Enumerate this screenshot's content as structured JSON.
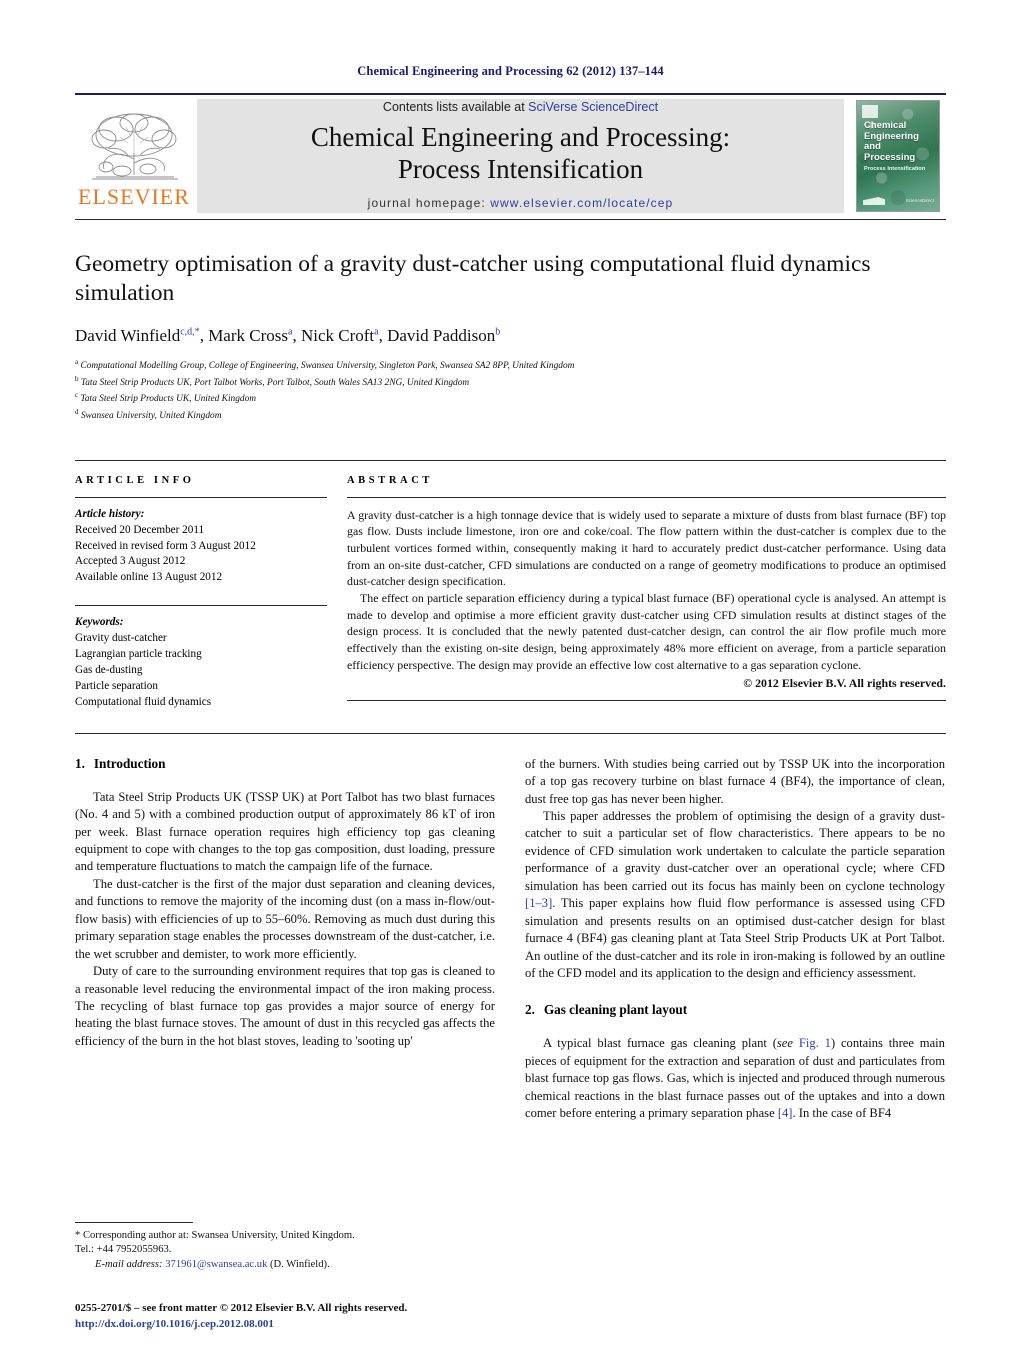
{
  "running_head": "Chemical Engineering and Processing 62 (2012) 137–144",
  "masthead": {
    "contents_prefix": "Contents lists available at ",
    "sciencedirect": "SciVerse ScienceDirect",
    "journal_title_line1": "Chemical Engineering and Processing:",
    "journal_title_line2": "Process Intensification",
    "homepage_label": "journal homepage: ",
    "homepage_url": "www.elsevier.com/locate/cep",
    "publisher_logo_text": "ELSEVIER",
    "cover": {
      "title": "Chemical Engineering and Processing",
      "subtitle": "Process Intensification",
      "bottom_text": "ScienceDirect"
    }
  },
  "article": {
    "title": "Geometry optimisation of a gravity dust-catcher using computational fluid dynamics simulation",
    "authors_html": "David Winfield<sup>c,d,</sup><sup>*</sup>, Mark Cross<sup>a</sup>, Nick Croft<sup>a</sup>, David Paddison<sup>b</sup>",
    "affiliations": [
      {
        "marker": "a",
        "text": "Computational Modelling Group, College of Engineering, Swansea University, Singleton Park, Swansea SA2 8PP, United Kingdom"
      },
      {
        "marker": "b",
        "text": "Tata Steel Strip Products UK, Port Talbot Works, Port Talbot, South Wales SA13 2NG, United Kingdom"
      },
      {
        "marker": "c",
        "text": "Tata Steel Strip Products UK, United Kingdom"
      },
      {
        "marker": "d",
        "text": "Swansea University, United Kingdom"
      }
    ]
  },
  "article_info": {
    "label": "ARTICLE INFO",
    "history_title": "Article history:",
    "history": [
      "Received 20 December 2011",
      "Received in revised form 3 August 2012",
      "Accepted 3 August 2012",
      "Available online 13 August 2012"
    ],
    "keywords_title": "Keywords:",
    "keywords": [
      "Gravity dust-catcher",
      "Lagrangian particle tracking",
      "Gas de-dusting",
      "Particle separation",
      "Computational fluid dynamics"
    ]
  },
  "abstract": {
    "label": "ABSTRACT",
    "paragraph1": "A gravity dust-catcher is a high tonnage device that is widely used to separate a mixture of dusts from blast furnace (BF) top gas flow. Dusts include limestone, iron ore and coke/coal. The flow pattern within the dust-catcher is complex due to the turbulent vortices formed within, consequently making it hard to accurately predict dust-catcher performance. Using data from an on-site dust-catcher, CFD simulations are conducted on a range of geometry modifications to produce an optimised dust-catcher design specification.",
    "paragraph2": "The effect on particle separation efficiency during a typical blast furnace (BF) operational cycle is analysed. An attempt is made to develop and optimise a more efficient gravity dust-catcher using CFD simulation results at distinct stages of the design process. It is concluded that the newly patented dust-catcher design, can control the air flow profile much more effectively than the existing on-site design, being approximately 48% more efficient on average, from a particle separation efficiency perspective. The design may provide an effective low cost alternative to a gas separation cyclone.",
    "copyright": "© 2012 Elsevier B.V. All rights reserved."
  },
  "body": {
    "section1": {
      "number": "1.",
      "title": "Introduction",
      "p1": "Tata Steel Strip Products UK (TSSP UK) at Port Talbot has two blast furnaces (No. 4 and 5) with a combined production output of approximately 86 kT of iron per week. Blast furnace operation requires high efficiency top gas cleaning equipment to cope with changes to the top gas composition, dust loading, pressure and temperature fluctuations to match the campaign life of the furnace.",
      "p2": "The dust-catcher is the first of the major dust separation and cleaning devices, and functions to remove the majority of the incoming dust (on a mass in-flow/out-flow basis) with efficiencies of up to 55–60%. Removing as much dust during this primary separation stage enables the processes downstream of the dust-catcher, i.e. the wet scrubber and demister, to work more efficiently.",
      "p3": "Duty of care to the surrounding environment requires that top gas is cleaned to a reasonable level reducing the environmental impact of the iron making process. The recycling of blast furnace top gas provides a major source of energy for heating the blast furnace stoves. The amount of dust in this recycled gas affects the efficiency of the burn in the hot blast stoves, leading to 'sooting up'",
      "p3_cont": "of the burners. With studies being carried out by TSSP UK into the incorporation of a top gas recovery turbine on blast furnace 4 (BF4), the importance of clean, dust free top gas has never been higher.",
      "p4_a": "This paper addresses the problem of optimising the design of a gravity dust-catcher to suit a particular set of flow characteristics. There appears to be no evidence of CFD simulation work undertaken to calculate the particle separation performance of a gravity dust-catcher over an operational cycle; where CFD simulation has been carried out its focus has mainly been on cyclone technology ",
      "p4_ref": "[1–3]",
      "p4_b": ". This paper explains how fluid flow performance is assessed using CFD simulation and presents results on an optimised dust-catcher design for blast furnace 4 (BF4) gas cleaning plant at Tata Steel Strip Products UK at Port Talbot. An outline of the dust-catcher and its role in iron-making is followed by an outline of the CFD model and its application to the design and efficiency assessment."
    },
    "section2": {
      "number": "2.",
      "title": "Gas cleaning plant layout",
      "p1_a": "A typical blast furnace gas cleaning plant (",
      "p1_see": "see",
      "p1_figref": "Fig. 1",
      "p1_b": ") contains three main pieces of equipment for the extraction and separation of dust and particulates from blast furnace top gas flows. Gas, which is injected and produced through numerous chemical reactions in the blast furnace passes out of the uptakes and into a down comer before entering a primary separation phase ",
      "p1_ref": "[4]",
      "p1_c": ". In the case of BF4"
    }
  },
  "footnotes": {
    "corresponding": "* Corresponding author at: Swansea University, United Kingdom.",
    "tel": "Tel.: +44 7952055963.",
    "email_label": "E-mail address:",
    "email": "371961@swansea.ac.uk",
    "email_suffix": " (D. Winfield).",
    "imprint": "0255-2701/$ – see front matter © 2012 Elsevier B.V. All rights reserved.",
    "doi": "http://dx.doi.org/10.1016/j.cep.2012.08.001"
  },
  "colors": {
    "link_blue": "#2b3f9e",
    "header_navy": "#1a1a6e",
    "elsevier_orange": "#E87722",
    "masthead_gray": "#e3e3e3"
  }
}
